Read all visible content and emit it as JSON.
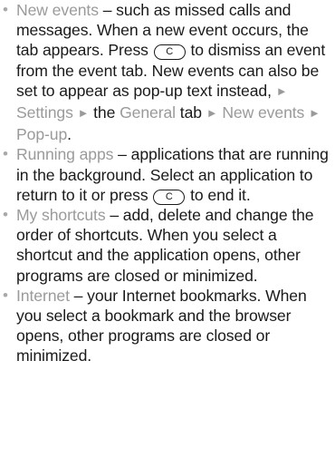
{
  "items": [
    {
      "term": "New events",
      "p1": " – such as missed calls and messages. When a new event occurs, the tab appears. Press ",
      "p2": " to dismiss an event from the event tab. New events can also be set to appear as pop-up text instead, ",
      "settings": "Settings",
      "the_text": " the ",
      "general": "General",
      "tab_text": " tab ",
      "newevents_menu": "New events",
      "popup": "Pop-up",
      "end": "."
    },
    {
      "term": "Running apps",
      "p1": " – applications that are running in the background. Select an application to return to it or press ",
      "p2": " to end it."
    },
    {
      "term": "My shortcuts",
      "text": " – add, delete and change the order of shortcuts. When you select a shortcut and the application opens, other programs are closed or minimized."
    },
    {
      "term": "Internet",
      "text": " – your Internet bookmarks. When you select a bookmark and the browser opens, other programs are closed or minimized."
    }
  ],
  "key_label": "C",
  "arrow_glyph": "►",
  "bullet_glyph": "•",
  "colors": {
    "text": "#1a1a1a",
    "highlight": "#9a9a9a"
  }
}
